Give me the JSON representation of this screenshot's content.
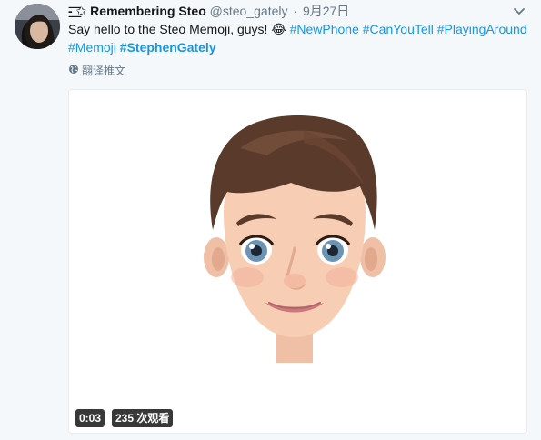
{
  "tweet": {
    "display_name": "-͟͟͞͞ ✩ Remembering Steo",
    "handle": "@steo_gately",
    "separator": "·",
    "timestamp": "9月27日",
    "text_before": "Say hello to the Steo Memoji, guys! ",
    "emoji": "😂",
    "hashtags": [
      "#NewPhone",
      "#CanYouTell",
      "#PlayingAround",
      "#Memoji",
      "#StephenGately"
    ],
    "translate_label": "翻译推文"
  },
  "video": {
    "duration": "0:03",
    "views": "235 次观看"
  },
  "colors": {
    "background": "#f5f8fa",
    "hashtag": "#1b95e0",
    "secondary_text": "#657786"
  },
  "icons": {
    "menu": "chevron-down-icon",
    "translate": "globe-icon",
    "emoji": "tears-of-joy-emoji"
  }
}
